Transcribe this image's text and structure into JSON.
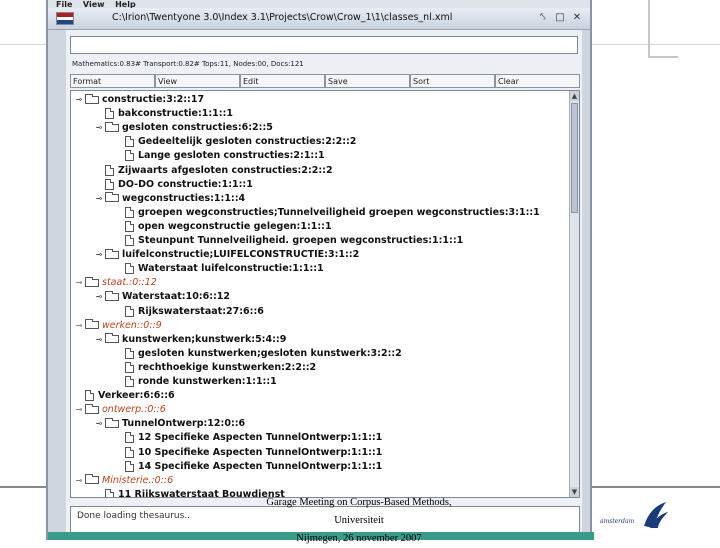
{
  "menubar": {
    "items": [
      "File",
      "View",
      "Help"
    ]
  },
  "window": {
    "title": "C:\\Irion\\Twentyone 3.0\\Index 3.1\\Projects\\Crow\\Crow_1\\1\\classes_nl.xml",
    "flag_colors": [
      "#ae1c28",
      "#ffffff",
      "#21468b"
    ]
  },
  "search": {
    "value": ""
  },
  "stats": "Mathematics:0.83# Transport:0.82# Tops:11, Nodes:00, Docs:121",
  "buttons": [
    "Format",
    "View",
    "Edit",
    "Save",
    "Sort",
    "Clear"
  ],
  "tree": [
    {
      "label": "constructie:3:2::17",
      "depth": 1,
      "icon": "folder",
      "toggle": "⊸",
      "style": "bold"
    },
    {
      "label": "bakconstructie:1:1::1",
      "depth": 2,
      "icon": "doc",
      "toggle": "",
      "style": "bold"
    },
    {
      "label": "gesloten constructies:6:2::5",
      "depth": 2,
      "icon": "folder",
      "toggle": "⊸",
      "style": "bold"
    },
    {
      "label": "Gedeeltelijk gesloten constructies:2:2::2",
      "depth": 3,
      "icon": "doc",
      "toggle": "",
      "style": "bold"
    },
    {
      "label": "Lange gesloten constructies:2:1::1",
      "depth": 3,
      "icon": "doc",
      "toggle": "",
      "style": "bold"
    },
    {
      "label": "Zijwaarts afgesloten constructies:2:2::2",
      "depth": 2,
      "icon": "doc",
      "toggle": "",
      "style": "bold"
    },
    {
      "label": "DO-DO constructie:1:1::1",
      "depth": 2,
      "icon": "doc",
      "toggle": "",
      "style": "bold"
    },
    {
      "label": "wegconstructies:1:1::4",
      "depth": 2,
      "icon": "folder",
      "toggle": "⊸",
      "style": "bold"
    },
    {
      "label": "groepen wegconstructies;Tunnelveiligheid groepen wegconstructies:3:1::1",
      "depth": 3,
      "icon": "doc",
      "toggle": "",
      "style": "bold"
    },
    {
      "label": "open wegconstructie gelegen:1:1::1",
      "depth": 3,
      "icon": "doc",
      "toggle": "",
      "style": "bold"
    },
    {
      "label": "Steunpunt Tunnelveiligheid. groepen wegconstructies:1:1::1",
      "depth": 3,
      "icon": "doc",
      "toggle": "",
      "style": "bold"
    },
    {
      "label": "luifelconstructie;LUIFELCONSTRUCTIE:3:1::2",
      "depth": 2,
      "icon": "folder",
      "toggle": "⊸",
      "style": "bold"
    },
    {
      "label": "Waterstaat luifelconstructie:1:1::1",
      "depth": 3,
      "icon": "doc",
      "toggle": "",
      "style": "bold"
    },
    {
      "label": "staat.:0::12",
      "depth": 1,
      "icon": "folder",
      "toggle": "⊸",
      "style": "italic"
    },
    {
      "label": "Waterstaat:10:6::12",
      "depth": 2,
      "icon": "folder",
      "toggle": "⊸",
      "style": "bold"
    },
    {
      "label": "Rijkswaterstaat:27:6::6",
      "depth": 3,
      "icon": "doc",
      "toggle": "",
      "style": "bold"
    },
    {
      "label": "werken::0::9",
      "depth": 1,
      "icon": "folder",
      "toggle": "⊸",
      "style": "italic"
    },
    {
      "label": "kunstwerken;kunstwerk:5:4::9",
      "depth": 2,
      "icon": "folder",
      "toggle": "⊸",
      "style": "bold"
    },
    {
      "label": "gesloten kunstwerken;gesloten kunstwerk:3:2::2",
      "depth": 3,
      "icon": "doc",
      "toggle": "",
      "style": "bold"
    },
    {
      "label": "rechthoekige kunstwerken:2:2::2",
      "depth": 3,
      "icon": "doc",
      "toggle": "",
      "style": "bold"
    },
    {
      "label": "ronde kunstwerken:1:1::1",
      "depth": 3,
      "icon": "doc",
      "toggle": "",
      "style": "bold"
    },
    {
      "label": "Verkeer:6:6::6",
      "depth": 1,
      "icon": "doc",
      "toggle": "",
      "style": "bold"
    },
    {
      "label": "ontwerp.:0::6",
      "depth": 1,
      "icon": "folder",
      "toggle": "⊸",
      "style": "italic"
    },
    {
      "label": "TunnelOntwerp:12:0::6",
      "depth": 2,
      "icon": "folder",
      "toggle": "⊸",
      "style": "bold"
    },
    {
      "label": "12 Specifieke Aspecten TunnelOntwerp:1:1::1",
      "depth": 3,
      "icon": "doc",
      "toggle": "",
      "style": "bold"
    },
    {
      "label": "10 Specifieke Aspecten TunnelOntwerp:1:1::1",
      "depth": 3,
      "icon": "doc",
      "toggle": "",
      "style": "bold"
    },
    {
      "label": "14 Specifieke Aspecten TunnelOntwerp:1:1::1",
      "depth": 3,
      "icon": "doc",
      "toggle": "",
      "style": "bold"
    },
    {
      "label": "Ministerie.:0::6",
      "depth": 1,
      "icon": "folder",
      "toggle": "⊸",
      "style": "italic"
    },
    {
      "label": "11 Rijkswaterstaat Bouwdienst",
      "depth": 2,
      "icon": "doc",
      "toggle": "",
      "style": "bold"
    }
  ],
  "status": {
    "text": "Done loading thesaurus.."
  },
  "footer": {
    "line1": "Garage Meeting on Corpus-Based Methods, Universiteit",
    "line2": "Nijmegen, 26 november 2007"
  },
  "logo": {
    "text": "amsterdam"
  }
}
